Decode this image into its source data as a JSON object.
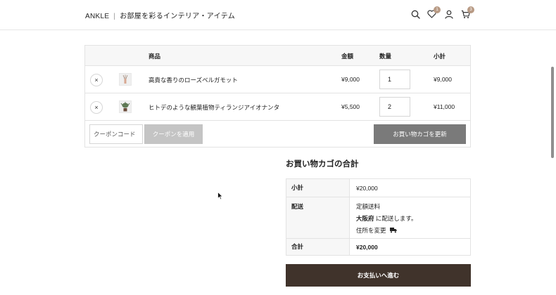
{
  "header": {
    "brand": "ANKLE",
    "tagline": "お部屋を彩るインテリア・アイテム",
    "wishlist_count": "1",
    "cart_count": "3",
    "icons": [
      "search-icon",
      "heart-icon",
      "user-icon",
      "cart-icon"
    ]
  },
  "cart": {
    "columns": {
      "product": "商品",
      "price": "金額",
      "quantity": "数量",
      "subtotal": "小計"
    },
    "items": [
      {
        "name": "高貴な香りのローズベルガモット",
        "price": "¥9,000",
        "quantity": "1",
        "subtotal": "¥9,000"
      },
      {
        "name": "ヒトデのような観葉植物ティランジアイオナンタ",
        "price": "¥5,500",
        "quantity": "2",
        "subtotal": "¥11,000"
      }
    ],
    "remove_symbol": "×",
    "coupon_placeholder": "クーポンコード",
    "coupon_button": "クーポンを適用",
    "update_button": "お買い物カゴを更新"
  },
  "totals": {
    "title": "お買い物カゴの合計",
    "subtotal_label": "小計",
    "subtotal_value": "¥20,000",
    "shipping_label": "配送",
    "shipping_method": "定額送料",
    "shipping_destination": "大阪府",
    "shipping_destination_suffix": " に配送します。",
    "change_address": "住所を変更",
    "total_label": "合計",
    "total_value": "¥20,000",
    "checkout_button": "お支払いへ進む"
  },
  "colors": {
    "badge": "#b89a84",
    "checkout_button": "#40332b",
    "update_button": "#7a7a7a",
    "coupon_button": "#c4c4c4"
  }
}
